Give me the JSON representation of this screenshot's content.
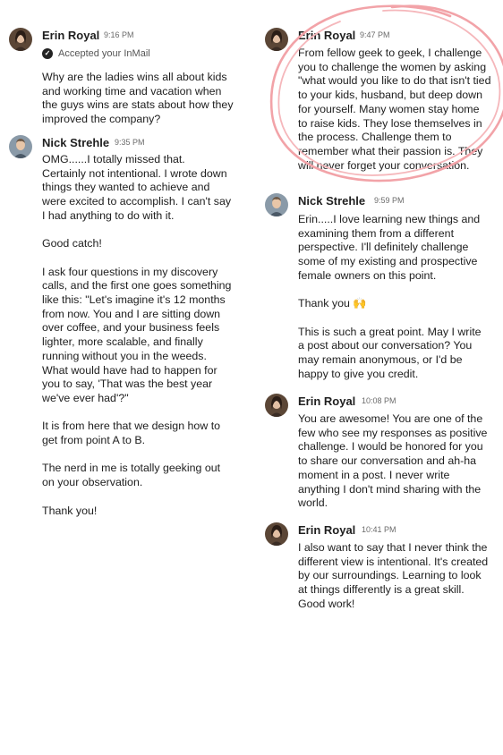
{
  "left_column": {
    "messages": [
      {
        "sender": "Erin Royal",
        "time": "9:16 PM",
        "system_note": "Accepted your InMail",
        "paragraphs": [
          "Why are the ladies wins all about kids and working time and vacation when the guys wins are stats about how they improved the company?"
        ]
      },
      {
        "sender": "Nick Strehle",
        "time": "9:35 PM",
        "paragraphs": [
          "OMG......I totally missed that. Certainly not intentional. I wrote down things they wanted to achieve and were excited to accomplish. I can't say I had anything to do with it.",
          "Good catch!",
          "I ask four questions in my discovery calls, and the first one goes something like this: \"Let's imagine it's 12 months from now. You and I are sitting down over coffee, and your business feels lighter, more scalable, and finally running without you in the weeds. What would have had to happen for you to say, 'That was the best year we've ever had'?\"",
          "It is from here that we design how to get from point A to B.",
          "The nerd in me is totally geeking out on your observation.",
          "Thank you!"
        ]
      }
    ]
  },
  "right_column": {
    "messages": [
      {
        "sender": "Erin Royal",
        "time": "9:47 PM",
        "paragraphs": [
          "From fellow geek to geek, I challenge you to challenge the women by asking \"what would you like to do that isn't tied to your kids, husband, but deep down for yourself. Many women stay home to raise kids. They lose themselves in the process. Challenge them to remember what their passion is. They will never forget your conversation."
        ]
      },
      {
        "sender": "Nick Strehle",
        "time": "9:59 PM",
        "paragraphs": [
          "Erin.....I love learning new things and examining them from a different perspective. I'll definitely challenge some of my existing and prospective female owners on this point.",
          "Thank you 🙌",
          "This is such a great point. May I write a post about our conversation? You may remain anonymous, or I'd be happy to give you credit."
        ]
      },
      {
        "sender": "Erin Royal",
        "time": "10:08 PM",
        "paragraphs": [
          "You are awesome! You are one of the few who see my responses as positive challenge. I would be honored for you to share our conversation and ah-ha moment in a post. I never write anything I don't mind sharing with the world."
        ]
      },
      {
        "sender": "Erin Royal",
        "time": "10:41 PM",
        "paragraphs": [
          "I also want to say that I never think the different view is intentional. It's created by our surroundings. Learning to look at things differently is a great skill. Good work!"
        ]
      }
    ]
  },
  "icons": {
    "accepted": "check-circle-icon",
    "avatar_erin": "avatar-erin-royal",
    "avatar_nick": "avatar-nick-strehle",
    "annotation": "hand-drawn-circle"
  },
  "colors": {
    "annotation_circle": "#f2a3a8",
    "time_text": "#6b6b6b",
    "body_text": "#202020"
  }
}
